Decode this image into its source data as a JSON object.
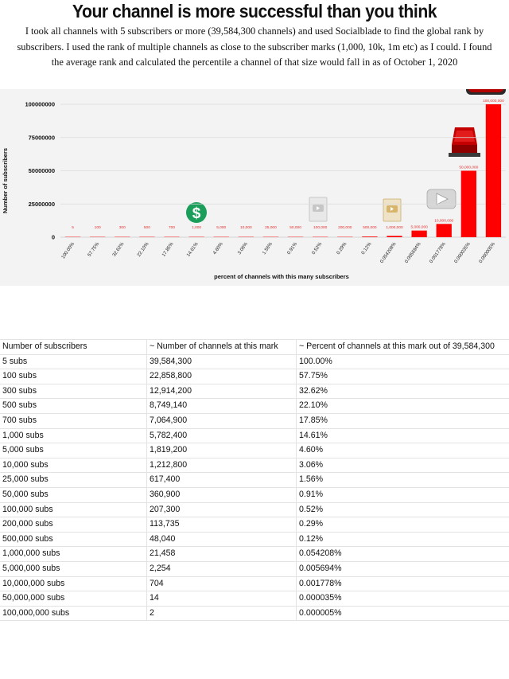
{
  "header": {
    "title": "Your channel is more successful than you think",
    "intro_lines": [
      "I took all channels with 5 subscribers or more (39,584,300 channels) and used Socialblade to find the global rank by",
      "subscribers. I used the rank of multiple channels as close to the subscriber marks (1,000, 10k, 1m etc) as I could. I found",
      "the average rank and calculated the percentile a channel of that size would fall in as of October 1, 2020"
    ]
  },
  "chart_data": {
    "type": "bar",
    "xlabel": "percent of channels with this many subscribers",
    "ylabel": "Number of subscribers",
    "ylim": [
      0,
      100000000
    ],
    "y_ticks": [
      "100000000",
      "75000000",
      "50000000",
      "25000000",
      "0"
    ],
    "y_tick_values": [
      100000000,
      75000000,
      50000000,
      25000000,
      0
    ],
    "categories": [
      "100.00%",
      "57.75%",
      "32.62%",
      "22.10%",
      "17.85%",
      "14.61%",
      "4.60%",
      "3.06%",
      "1.56%",
      "0.91%",
      "0.52%",
      "0.29%",
      "0.12%",
      "0.054208%",
      "0.005694%",
      "0.001778%",
      "0.000035%",
      "0.000005%"
    ],
    "values": [
      5,
      100,
      300,
      500,
      700,
      1000,
      5000,
      10000,
      25000,
      50000,
      100000,
      200000,
      500000,
      1000000,
      5000000,
      10000000,
      50000000,
      100000000
    ],
    "data_labels": [
      "5",
      "100",
      "300",
      "500",
      "700",
      "1,000",
      "5,000",
      "10,000",
      "25,000",
      "50,000",
      "100,000",
      "200,000",
      "500,000",
      "1,000,000",
      "5,000,000",
      "10,000,000",
      "50,000,000",
      "100,000,000"
    ],
    "bar_color": "#ff0000",
    "grid": true,
    "legend": "none"
  },
  "table": {
    "columns": [
      "Number of subscribers",
      "~ Number of channels at this mark",
      "~ Percent of channels at this mark out of 39,584,300"
    ],
    "rows": [
      [
        "5 subs",
        "39,584,300",
        "100.00%"
      ],
      [
        "100 subs",
        "22,858,800",
        "57.75%"
      ],
      [
        "300 subs",
        "12,914,200",
        "32.62%"
      ],
      [
        "500 subs",
        "8,749,140",
        "22.10%"
      ],
      [
        "700 subs",
        "7,064,900",
        "17.85%"
      ],
      [
        "1,000 subs",
        "5,782,400",
        "14.61%"
      ],
      [
        "5,000 subs",
        "1,819,200",
        "4.60%"
      ],
      [
        "10,000 subs",
        "1,212,800",
        "3.06%"
      ],
      [
        "25,000 subs",
        "617,400",
        "1.56%"
      ],
      [
        "50,000 subs",
        "360,900",
        "0.91%"
      ],
      [
        "100,000 subs",
        "207,300",
        "0.52%"
      ],
      [
        "200,000 subs",
        "113,735",
        "0.29%"
      ],
      [
        "500,000 subs",
        "48,040",
        "0.12%"
      ],
      [
        "1,000,000 subs",
        "21,458",
        "0.054208%"
      ],
      [
        "5,000,000 subs",
        "2,254",
        "0.005694%"
      ],
      [
        "10,000,000 subs",
        "704",
        "0.001778%"
      ],
      [
        "50,000,000 subs",
        "14",
        "0.000035%"
      ],
      [
        "100,000,000 subs",
        "2",
        "0.000005%"
      ]
    ]
  },
  "icons": {
    "play_logo": "youtube-play-logo-icon",
    "monetization": "dollar-sign-icon",
    "award_silver": "silver-play-button-icon",
    "award_gold": "gold-play-button-icon",
    "award_diamond": "diamond-play-button-icon",
    "award_ruby": "red-diamond-play-button-icon"
  },
  "colors": {
    "bar": "#ff0000",
    "dollar_circle": "#1a9e5a",
    "panel_bg": "#f3f3f3",
    "label_red": "#e83030"
  }
}
